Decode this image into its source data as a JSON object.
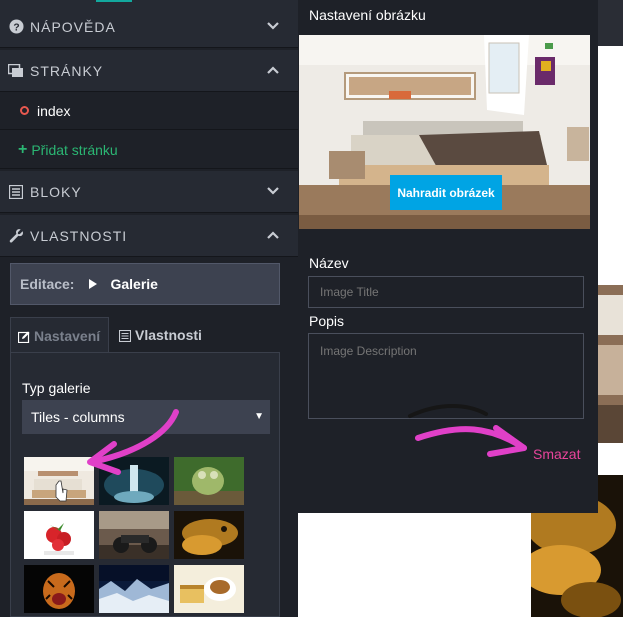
{
  "sidebar": {
    "sections": [
      {
        "label": "NÁPOVĚDA",
        "icon": "question-circle-icon",
        "chevron": "down"
      },
      {
        "label": "STRÁNKY",
        "icon": "pages-icon",
        "chevron": "up"
      },
      {
        "label": "BLOKY",
        "icon": "blocks-list-icon",
        "chevron": "down"
      },
      {
        "label": "VLASTNOSTI",
        "icon": "wrench-icon",
        "chevron": "up"
      }
    ],
    "pages": [
      {
        "label": "index"
      }
    ],
    "add_page_label": "Přidat stránku"
  },
  "editor": {
    "edit_label": "Editace:",
    "edit_target": "Galerie",
    "tabs": [
      {
        "label": "Nastavení",
        "icon": "edit-icon",
        "active": true
      },
      {
        "label": "Vlastnosti",
        "icon": "list-icon",
        "active": false
      }
    ],
    "gallery_type_label": "Typ galerie",
    "gallery_type_value": "Tiles - columns",
    "thumbnails": [
      "bedroom-thumbnail",
      "waterfall-thumbnail",
      "frog-statue-thumbnail",
      "strawberries-thumbnail",
      "motorbike-thumbnail",
      "lizard-thumbnail",
      "tiger-thumbnail",
      "mountains-thumbnail",
      "coffee-cake-thumbnail"
    ]
  },
  "modal": {
    "title": "Nastavení obrázku",
    "replace_button": "Nahradit obrázek",
    "name_label": "Název",
    "name_placeholder": "Image Title",
    "description_label": "Popis",
    "description_placeholder": "Image Description",
    "delete_label": "Smazat"
  },
  "colors": {
    "sidebar_bg": "#1e2128",
    "accent_blue": "#00a4e4",
    "add_green": "#2bb673",
    "delete_pink": "#e8449b",
    "annotation_arrow": "#e040c8"
  }
}
